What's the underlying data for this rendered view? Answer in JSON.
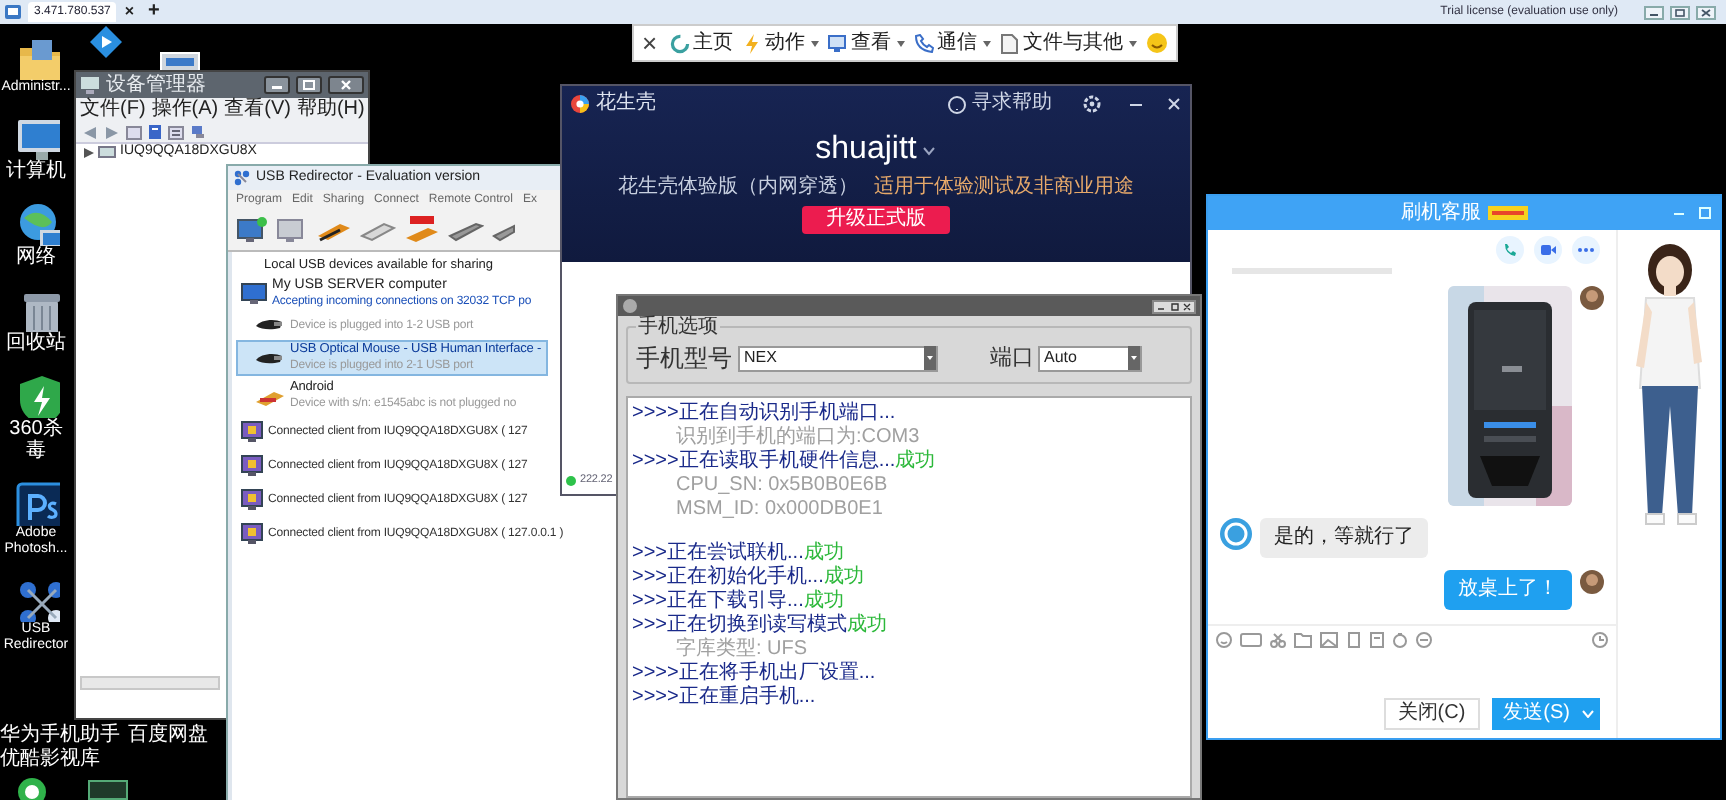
{
  "remote_tab_bar": {
    "tab": "3.471.780.537",
    "close": "×",
    "add": "+",
    "license": "Trial license (evaluation use only)"
  },
  "remote_toolbar": {
    "close": "×",
    "items": [
      {
        "label": "主页",
        "dropdown": false
      },
      {
        "label": "动作",
        "dropdown": true
      },
      {
        "label": "查看",
        "dropdown": true
      },
      {
        "label": "通信",
        "dropdown": true
      },
      {
        "label": "文件与其他",
        "dropdown": true
      }
    ]
  },
  "desktop_icons": [
    {
      "label": "Administr...",
      "kind": "folder"
    },
    {
      "label": "计算机",
      "kind": "computer"
    },
    {
      "label": "网络",
      "kind": "network"
    },
    {
      "label": "回收站",
      "kind": "trash"
    },
    {
      "label": "360杀毒",
      "kind": "shield"
    },
    {
      "label": "Adobe Photosh...",
      "kind": "ps"
    },
    {
      "label": "USB Redirector",
      "kind": "usb"
    }
  ],
  "bottom_icons": [
    {
      "label": "华为手机助手"
    },
    {
      "label": "百度网盘"
    },
    {
      "label": "优酷影视库"
    }
  ],
  "device_manager": {
    "title": "设备管理器",
    "menu": [
      "文件(F)",
      "操作(A)",
      "查看(V)",
      "帮助(H)"
    ],
    "tree_root": "IUQ9QQA18DXGU8X"
  },
  "usb_redirector": {
    "title": "USB Redirector - Evaluation version",
    "menu": [
      "Program",
      "Edit",
      "Sharing",
      "Connect",
      "Remote Control",
      "Ex"
    ],
    "section": "Local USB devices available for sharing",
    "server": {
      "name": "My USB SERVER computer",
      "status": "Accepting incoming connections on 32032 TCP po"
    },
    "devices": [
      {
        "detail": "Device is plugged into 1-2 USB port",
        "kind": "mouse",
        "selected": false
      },
      {
        "name": "USB Optical Mouse - USB Human Interface -",
        "detail": "Device is plugged into 2-1 USB port",
        "kind": "mouse",
        "selected": true
      },
      {
        "name": "Android",
        "detail": "Device with s/n: e1545abc is not plugged no",
        "kind": "android",
        "selected": false
      }
    ],
    "clients": [
      "Connected client from IUQ9QQA18DXGU8X ( 127",
      "Connected client from IUQ9QQA18DXGU8X ( 127",
      "Connected client from IUQ9QQA18DXGU8X ( 127",
      "Connected client from IUQ9QQA18DXGU8X ( 127.0.0.1 )"
    ]
  },
  "huashengke": {
    "title": "花生壳",
    "help": "寻求帮助",
    "user": "shuajitt",
    "edition": "花生壳体验版（内网穿透）",
    "usage": "适用于体验测试及非商业用途",
    "upgrade": "升级正式版",
    "host": "222.22"
  },
  "flash_tool": {
    "group": "手机选项",
    "model_label": "手机型号",
    "model": "NEX",
    "port_label": "端口",
    "port": "Auto",
    "log": [
      {
        "text": ">>>>正在自动识别手机端口...",
        "kind": "step"
      },
      {
        "text": "识别到手机的端口为:COM3",
        "kind": "detail"
      },
      {
        "text": ">>>>正在读取手机硬件信息...",
        "kind": "step",
        "status": "成功"
      },
      {
        "text": "CPU_SN:   0x5B0B0E6B",
        "kind": "detail"
      },
      {
        "text": "MSM_ID:   0x000DB0E1",
        "kind": "detail"
      },
      {
        "text": ">>>正在尝试联机...",
        "kind": "step",
        "status": "成功",
        "gap_before": true
      },
      {
        "text": ">>>正在初始化手机...",
        "kind": "step",
        "status": "成功"
      },
      {
        "text": ">>>正在下载引导...",
        "kind": "step",
        "status": "成功"
      },
      {
        "text": ">>>正在切换到读写模式",
        "kind": "step",
        "status": "成功"
      },
      {
        "text": "字库类型:   UFS",
        "kind": "detail"
      },
      {
        "text": ">>>>正在将手机出厂设置...",
        "kind": "step"
      },
      {
        "text": ">>>>正在重启手机...",
        "kind": "step"
      }
    ]
  },
  "chat": {
    "title": "刷机客服",
    "messages": [
      {
        "kind": "sent_image"
      },
      {
        "kind": "received_text",
        "text": "是的，等就行了"
      },
      {
        "kind": "sent_text",
        "text": "放桌上了！"
      }
    ],
    "close_button": "关闭(C)",
    "send_button": "发送(S)"
  }
}
